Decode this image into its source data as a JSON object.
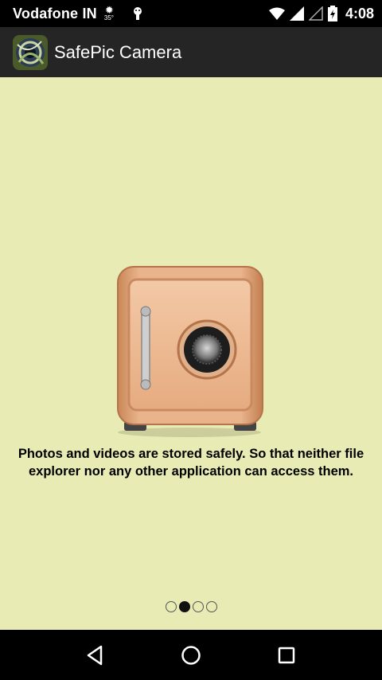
{
  "status_bar": {
    "carrier": "Vodafone IN",
    "weather_temp": "35°",
    "time": "4:08",
    "icons": [
      "weather-sun-icon",
      "android-icon",
      "wifi-icon",
      "signal-icon",
      "signal-empty-icon",
      "battery-icon"
    ]
  },
  "app": {
    "title": "SafePic Camera",
    "icon": "app-logo-icon"
  },
  "onboarding": {
    "description": "Photos and videos are stored safely. So that neither file explorer nor any other application can access them.",
    "illustration": "safe-icon",
    "pager": {
      "count": 4,
      "active_index": 1
    }
  },
  "nav_bar": {
    "buttons": [
      "back-icon",
      "home-icon",
      "recents-icon"
    ]
  },
  "colors": {
    "content_bg": "#e8ebb3",
    "action_bar_bg": "#252525",
    "safe_body": "#e3a97e"
  }
}
